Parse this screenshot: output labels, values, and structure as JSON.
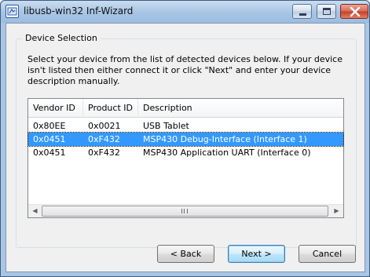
{
  "window": {
    "title": "libusb-win32 Inf-Wizard"
  },
  "group": {
    "title": "Device Selection",
    "instructions": "Select your device from the list of detected devices below. If your device isn't listed then either connect it or click \"Next\" and enter your device description manually."
  },
  "list": {
    "columns": [
      "Vendor ID",
      "Product ID",
      "Description"
    ],
    "rows": [
      {
        "vendor": "0x80EE",
        "product": "0x0021",
        "description": "USB Tablet",
        "selected": false
      },
      {
        "vendor": "0x0451",
        "product": "0xF432",
        "description": "MSP430 Debug-Interface (Interface 1)",
        "selected": true
      },
      {
        "vendor": "0x0451",
        "product": "0xF432",
        "description": "MSP430 Application UART (Interface 0)",
        "selected": false
      }
    ]
  },
  "buttons": {
    "back": "< Back",
    "next": "Next >",
    "cancel": "Cancel"
  },
  "colors": {
    "selection": "#3399ff",
    "titlebar": "#a9c6e6",
    "close": "#c7412b"
  },
  "icons": [
    "app-icon",
    "minimize-icon",
    "maximize-icon",
    "close-icon",
    "scroll-left-icon",
    "scroll-right-icon"
  ]
}
